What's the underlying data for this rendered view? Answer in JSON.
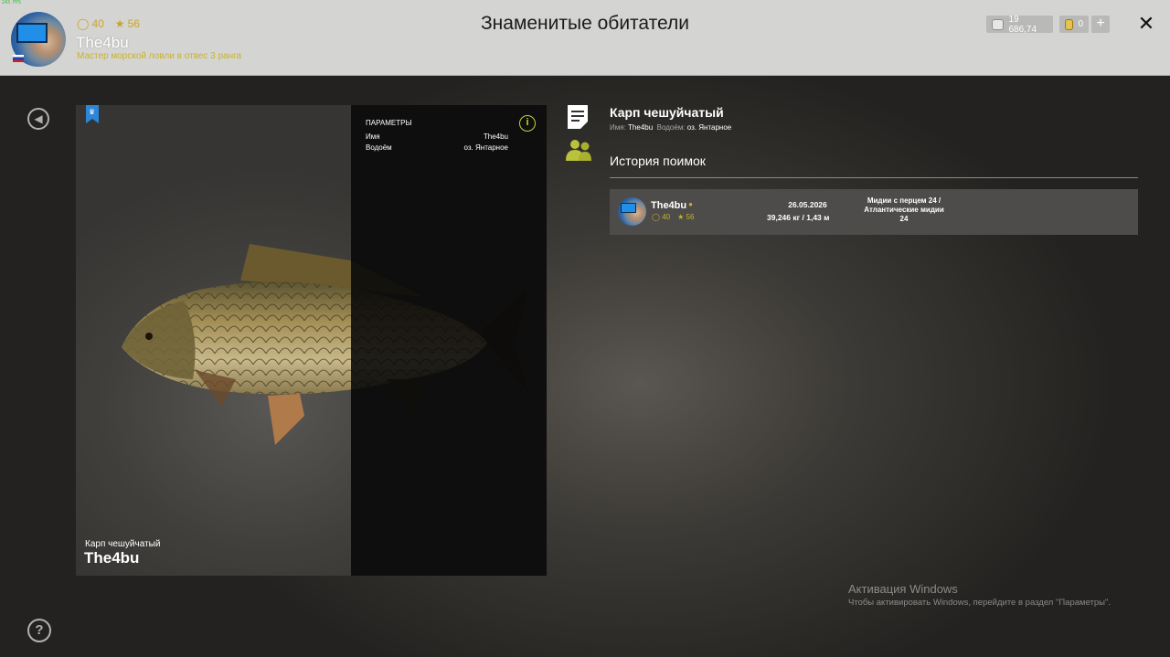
{
  "hud": {
    "fps": "243 FPS"
  },
  "header": {
    "title": "Знаменитые обитатели",
    "player": {
      "name": "The4bu",
      "rank": "Мастер морской ловли в отвес 3 ранга",
      "level": "40",
      "stars": "56"
    },
    "currency": {
      "silver": "19 686,74",
      "gold": "0",
      "add_label": "+"
    },
    "close_label": "✕"
  },
  "nav": {
    "back_glyph": "◀",
    "help_glyph": "?"
  },
  "card": {
    "fish_label": "Карп чешуйчатый",
    "owner": "The4bu",
    "params": {
      "title": "ПАРАМЕТРЫ",
      "rows": [
        {
          "key": "Имя",
          "value": "The4bu"
        },
        {
          "key": "Водоём",
          "value": "оз. Янтарное"
        }
      ],
      "info_glyph": "i"
    }
  },
  "details": {
    "fish_title": "Карп чешуйчатый",
    "name_key": "Имя:",
    "name_value": "The4bu",
    "water_key": "Водоём:",
    "water_value": "оз. Янтарное",
    "history_title": "История поимок",
    "history": [
      {
        "name": "The4bu",
        "level": "40",
        "stars": "56",
        "date": "26.05.2026",
        "weight": "39,246 кг  / 1,43 м",
        "bait_line1": "Мидии с перцем 24  /",
        "bait_line2": "Атлантические мидии",
        "bait_line3": "24"
      }
    ]
  },
  "watermark": {
    "title": "Активация Windows",
    "subtitle": "Чтобы активировать Windows, перейдите в раздел \"Параметры\"."
  },
  "icons": {
    "level": "ring-icon",
    "stars": "star-icon",
    "silver": "silver-coin-icon",
    "gold": "gold-coin-icon",
    "bookmark": "crown-bookmark-icon",
    "document": "document-icon",
    "group": "group-icon"
  },
  "colors": {
    "header_bg": "#d4d4d2",
    "accent_yellow": "#c8b32c",
    "info_green": "#c8d232",
    "bookmark_blue": "#2d86d6"
  }
}
